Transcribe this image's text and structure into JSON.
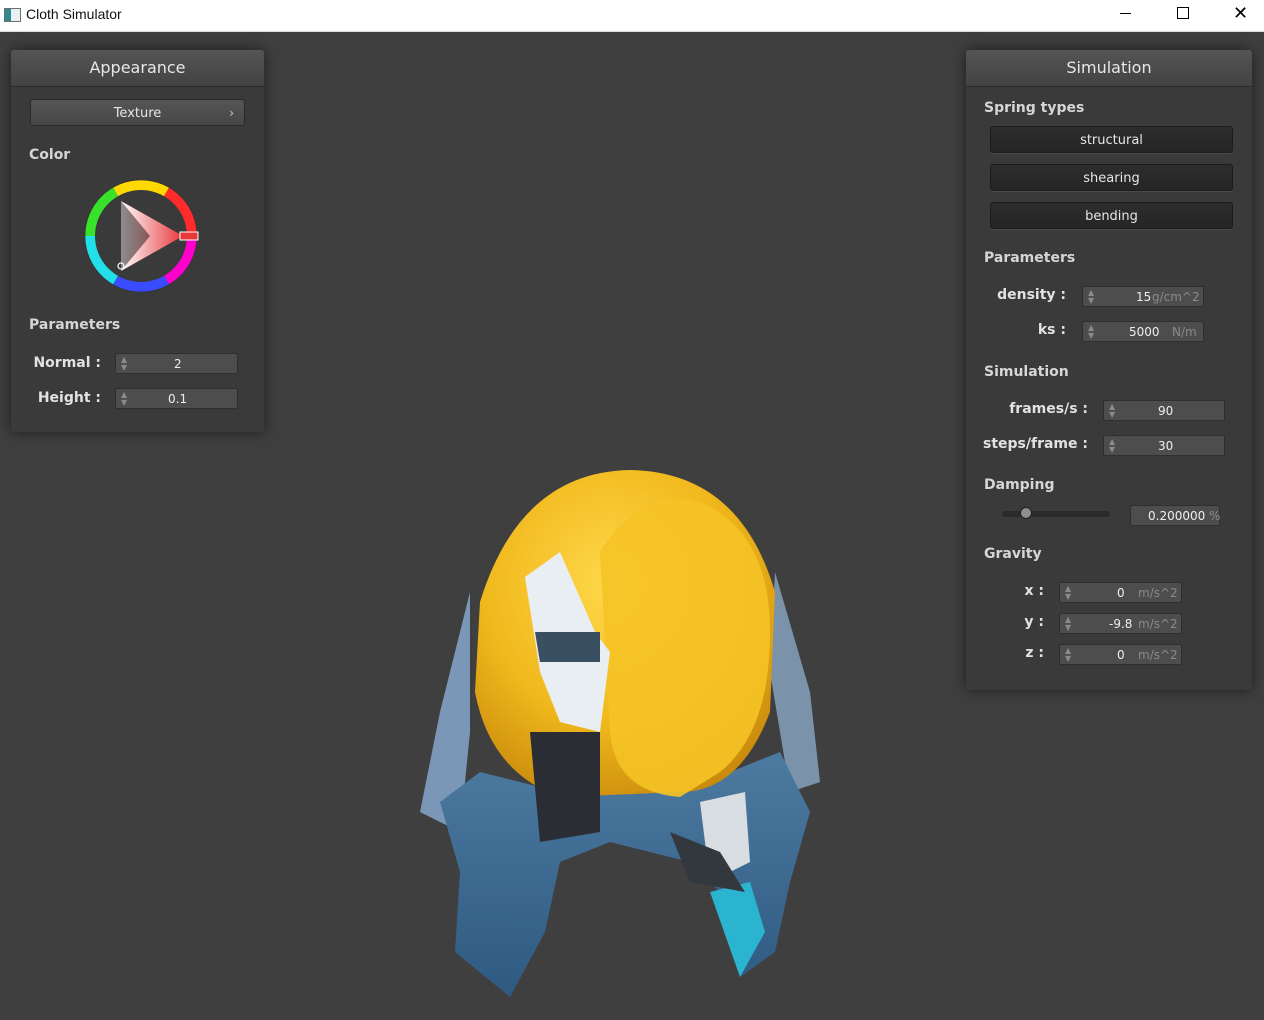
{
  "window": {
    "title": "Cloth Simulator"
  },
  "appearance": {
    "header": "Appearance",
    "texture_button": "Texture",
    "color_label": "Color",
    "parameters_label": "Parameters",
    "normal_label": "Normal :",
    "normal_value": "2",
    "height_label": "Height :",
    "height_value": "0.1",
    "selected_color": "#e8383a"
  },
  "simulation": {
    "header": "Simulation",
    "spring_types_label": "Spring types",
    "structural": "structural",
    "shearing": "shearing",
    "bending": "bending",
    "parameters_label": "Parameters",
    "density_label": "density :",
    "density_value": "15",
    "density_unit": "g/cm^2",
    "ks_label": "ks :",
    "ks_value": "5000",
    "ks_unit": "N/m",
    "simulation_label": "Simulation",
    "fps_label": "frames/s :",
    "fps_value": "90",
    "steps_label": "steps/frame :",
    "steps_value": "30",
    "damping_label": "Damping",
    "damping_value": "0.200000",
    "damping_unit": "%",
    "damping_fraction": 0.2,
    "gravity_label": "Gravity",
    "gx_label": "x :",
    "gx_value": "0",
    "gy_label": "y :",
    "gy_value": "-9.8",
    "gz_label": "z :",
    "gz_value": "0",
    "gravity_unit": "m/s^2"
  }
}
